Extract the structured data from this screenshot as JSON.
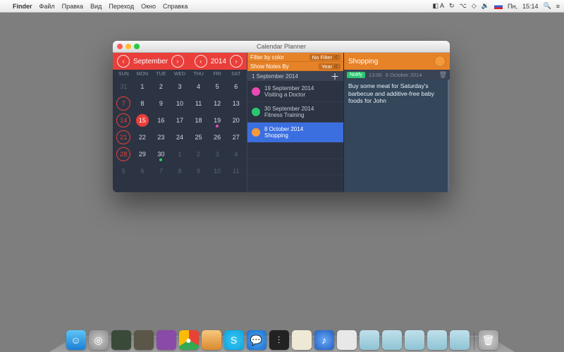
{
  "menubar": {
    "app": "Finder",
    "items": [
      "Файл",
      "Правка",
      "Вид",
      "Переход",
      "Окно",
      "Справка"
    ],
    "right": {
      "day": "Пн,",
      "time": "15:14"
    }
  },
  "window": {
    "title": "Calendar Planner",
    "cal": {
      "month": "September",
      "year": "2014",
      "weekdays": [
        "SUN",
        "MON",
        "TUE",
        "WED",
        "THU",
        "FRI",
        "SAT"
      ],
      "cells": [
        {
          "n": "31",
          "pm": true
        },
        {
          "n": "1"
        },
        {
          "n": "2"
        },
        {
          "n": "3"
        },
        {
          "n": "4"
        },
        {
          "n": "5"
        },
        {
          "n": "6"
        },
        {
          "n": "7",
          "sun": true,
          "circ": true
        },
        {
          "n": "8"
        },
        {
          "n": "9"
        },
        {
          "n": "10"
        },
        {
          "n": "11"
        },
        {
          "n": "12"
        },
        {
          "n": "13"
        },
        {
          "n": "14",
          "sun": true,
          "circ": true
        },
        {
          "n": "15",
          "sel": true
        },
        {
          "n": "16"
        },
        {
          "n": "17"
        },
        {
          "n": "18"
        },
        {
          "n": "19",
          "dot": "pink"
        },
        {
          "n": "20"
        },
        {
          "n": "21",
          "sun": true,
          "circ": true
        },
        {
          "n": "22"
        },
        {
          "n": "23"
        },
        {
          "n": "24"
        },
        {
          "n": "25"
        },
        {
          "n": "26"
        },
        {
          "n": "27"
        },
        {
          "n": "28",
          "sun": true,
          "circ": true
        },
        {
          "n": "29"
        },
        {
          "n": "30",
          "dot": "green"
        },
        {
          "n": "1",
          "pm": true
        },
        {
          "n": "2",
          "pm": true
        },
        {
          "n": "3",
          "pm": true
        },
        {
          "n": "4",
          "pm": true
        },
        {
          "n": "5",
          "pm": true
        },
        {
          "n": "6",
          "pm": true
        },
        {
          "n": "7",
          "pm": true
        },
        {
          "n": "8",
          "pm": true
        },
        {
          "n": "9",
          "pm": true
        },
        {
          "n": "10",
          "pm": true
        },
        {
          "n": "11",
          "pm": true
        }
      ]
    },
    "filters": {
      "color_label": "Filter by color",
      "color_value": "No Filter",
      "notes_label": "Show Notes By",
      "notes_value": "Year"
    },
    "events_header": "1 September 2014",
    "events": [
      {
        "color": "#e84bb3",
        "date": "19 September 2014",
        "title": "Visiting a Doctor"
      },
      {
        "color": "#28c76f",
        "date": "30 September 2014",
        "title": "Fitness Training"
      },
      {
        "color": "#f59a3a",
        "date": "8 October 2014",
        "title": "Shopping",
        "selected": true
      }
    ],
    "detail": {
      "title": "Shopping",
      "notify": "Notify",
      "time": "13:00",
      "date": "8 October 2014",
      "note": "Buy some meat for Saturday's barbecue and additive-free baby foods for John"
    }
  },
  "dock": {
    "icons": [
      {
        "name": "finder",
        "bg": "linear-gradient(#5ec4f7,#1b7fd4)",
        "glyph": "☺"
      },
      {
        "name": "launchpad",
        "bg": "radial-gradient(circle,#ccc,#888)",
        "glyph": "◎"
      },
      {
        "name": "app1",
        "bg": "#3a4a3a",
        "glyph": ""
      },
      {
        "name": "app2",
        "bg": "#5a5648",
        "glyph": ""
      },
      {
        "name": "app3",
        "bg": "#8a4aa8",
        "glyph": ""
      },
      {
        "name": "chrome",
        "bg": "conic-gradient(#ea4335 0 33%,#34a853 33% 66%,#fbbc05 66%)",
        "glyph": "●"
      },
      {
        "name": "photos",
        "bg": "linear-gradient(#f7c77e,#d98a2e)",
        "glyph": ""
      },
      {
        "name": "skype",
        "bg": "radial-gradient(circle,#3ac6f2,#0aa4e0)",
        "glyph": "S"
      },
      {
        "name": "messages",
        "bg": "radial-gradient(circle,#4ea8f2,#1b6fd0)",
        "glyph": "💬"
      },
      {
        "name": "activity",
        "bg": "#222",
        "glyph": "⫶"
      },
      {
        "name": "notes",
        "bg": "#efe8d6",
        "glyph": ""
      },
      {
        "name": "itunes",
        "bg": "radial-gradient(circle,#6aa8f7,#1f5fc0)",
        "glyph": "♪"
      },
      {
        "name": "terminal",
        "bg": "#e8e8e8",
        "glyph": ""
      },
      {
        "name": "folder1",
        "bg": "linear-gradient(#bfe0eb,#8fc3d4)",
        "glyph": ""
      },
      {
        "name": "folder2",
        "bg": "linear-gradient(#bfe0eb,#8fc3d4)",
        "glyph": ""
      },
      {
        "name": "folder3",
        "bg": "linear-gradient(#bfe0eb,#8fc3d4)",
        "glyph": ""
      },
      {
        "name": "folder4",
        "bg": "linear-gradient(#bfe0eb,#8fc3d4)",
        "glyph": ""
      },
      {
        "name": "folder5",
        "bg": "linear-gradient(#bfe0eb,#8fc3d4)",
        "glyph": ""
      }
    ],
    "trash": {
      "name": "trash",
      "bg": "radial-gradient(circle,#d0d0d0,#9a9a9a)",
      "glyph": "🗑"
    }
  }
}
